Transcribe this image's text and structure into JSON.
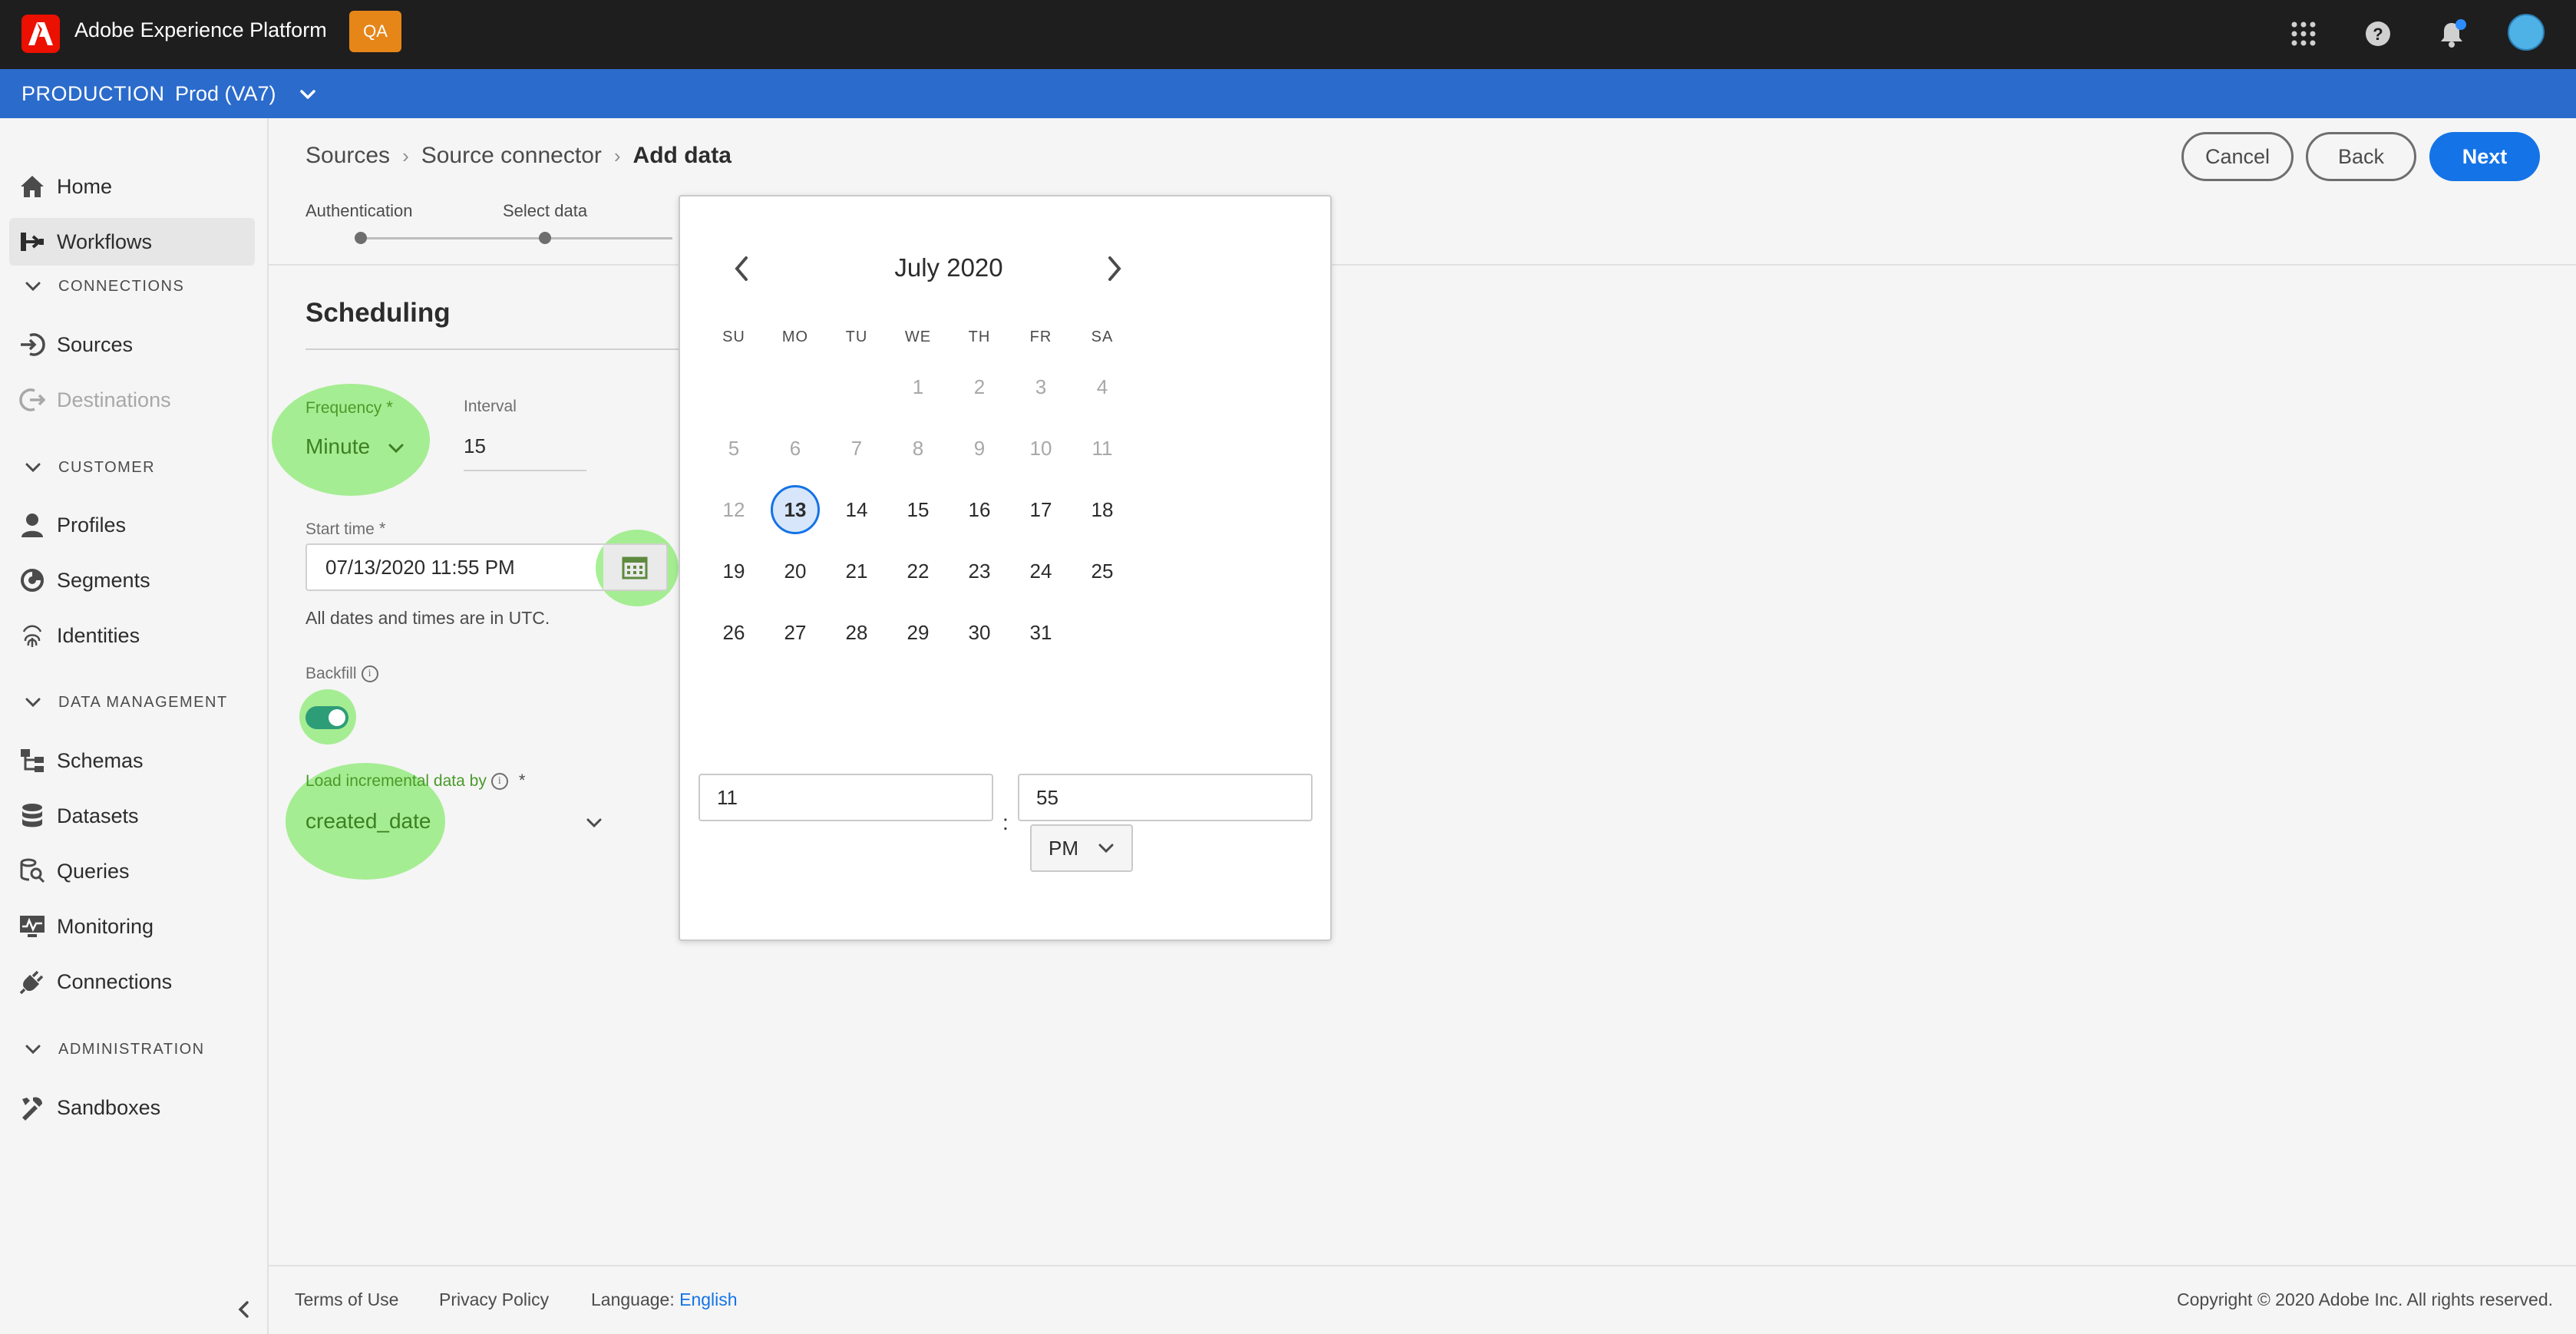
{
  "app": {
    "title": "Adobe Experience Platform",
    "env_badge": "QA"
  },
  "env": {
    "label": "PRODUCTION",
    "sandbox": "Prod (VA7)"
  },
  "sidebar": {
    "home": "Home",
    "workflows": "Workflows",
    "section_connections": "CONNECTIONS",
    "sources": "Sources",
    "destinations": "Destinations",
    "section_customer": "CUSTOMER",
    "profiles": "Profiles",
    "segments": "Segments",
    "identities": "Identities",
    "section_data_management": "DATA MANAGEMENT",
    "schemas": "Schemas",
    "datasets": "Datasets",
    "queries": "Queries",
    "monitoring": "Monitoring",
    "connections": "Connections",
    "section_administration": "ADMINISTRATION",
    "sandboxes": "Sandboxes"
  },
  "breadcrumb": {
    "item1": "Sources",
    "item2": "Source connector",
    "current": "Add data"
  },
  "header_buttons": {
    "cancel": "Cancel",
    "back": "Back",
    "next": "Next"
  },
  "steps": {
    "step1": "Authentication",
    "step2": "Select data"
  },
  "scheduling": {
    "title": "Scheduling",
    "frequency_label": "Frequency",
    "frequency_value": "Minute",
    "interval_label": "Interval",
    "interval_value": "15",
    "start_time_label": "Start time",
    "start_time_value": "07/13/2020 11:55 PM",
    "utc_note": "All dates and times are in UTC.",
    "backfill_label": "Backfill",
    "backfill_on": true,
    "incremental_label": "Load incremental data by",
    "incremental_value": "created_date",
    "required_mark": "*",
    "info_mark": "i"
  },
  "calendar": {
    "month": "July 2020",
    "weekdays": [
      "SU",
      "MO",
      "TU",
      "WE",
      "TH",
      "FR",
      "SA"
    ],
    "weeks": [
      [
        "",
        "",
        "",
        "1",
        "2",
        "3",
        "4"
      ],
      [
        "5",
        "6",
        "7",
        "8",
        "9",
        "10",
        "11"
      ],
      [
        "12",
        "13",
        "14",
        "15",
        "16",
        "17",
        "18"
      ],
      [
        "19",
        "20",
        "21",
        "22",
        "23",
        "24",
        "25"
      ],
      [
        "26",
        "27",
        "28",
        "29",
        "30",
        "31",
        ""
      ]
    ],
    "selected_day": "13",
    "hour": "11",
    "minute": "55",
    "colon": ":",
    "ampm": "PM"
  },
  "footer": {
    "terms": "Terms of Use",
    "privacy": "Privacy Policy",
    "language_label": "Language:",
    "language_value": "English",
    "copyright": "Copyright ©  2020 Adobe Inc.  All rights reserved."
  },
  "colors": {
    "accent": "#1473e6",
    "env_bar": "#2b6bcc",
    "highlight": "#7ae85c",
    "toggle_on": "#2d9d78"
  }
}
